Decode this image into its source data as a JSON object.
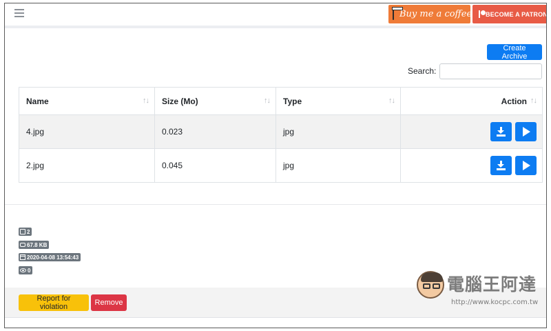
{
  "header": {
    "coffee_label": "Buy me a coffee",
    "patron_label": "BECOME A PATRON"
  },
  "toolbar": {
    "create_archive_label": "Create Archive",
    "search_label": "Search:",
    "search_value": ""
  },
  "table": {
    "columns": [
      "Name",
      "Size (Mo)",
      "Type",
      "Action"
    ],
    "rows": [
      {
        "name": "4.jpg",
        "size": "0.023",
        "type": "jpg"
      },
      {
        "name": "2.jpg",
        "size": "0.045",
        "type": "jpg"
      }
    ]
  },
  "stats": {
    "files": "2",
    "size": "67.8 KB",
    "date": "2020-04-08 13:54:43",
    "views": "0"
  },
  "footer": {
    "report_label": "Report for violation",
    "remove_label": "Remove"
  },
  "watermark": {
    "title": "電腦王阿達",
    "url": "http://www.kocpc.com.tw"
  },
  "colors": {
    "primary": "#0d7cf2",
    "warning": "#f8c10a",
    "danger": "#dc3545",
    "coffee": "#ef7b38",
    "patreon": "#e85b46",
    "badge": "#6c757d"
  },
  "icons": {
    "menu": "hamburger-icon",
    "coffee": "coffee-cup-icon",
    "patreon": "patreon-icon",
    "download": "download-icon",
    "play": "play-icon",
    "file": "file-icon",
    "drive": "hard-drive-icon",
    "calendar": "calendar-icon",
    "eye": "eye-icon"
  }
}
